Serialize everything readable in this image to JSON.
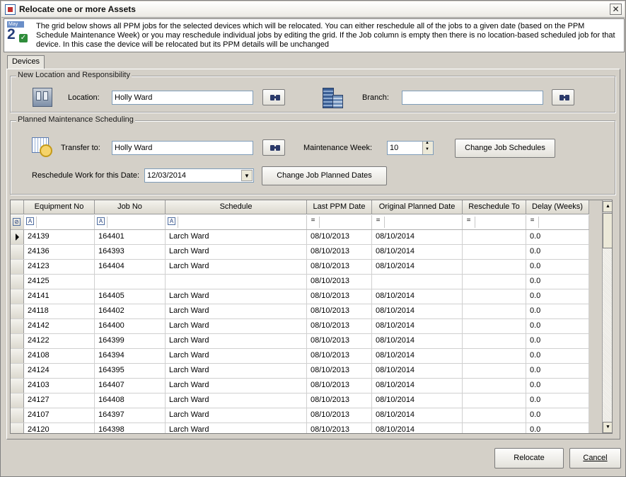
{
  "window": {
    "title": "Relocate one or more Assets",
    "close_label": "✕"
  },
  "info": {
    "calendar_month": "May",
    "calendar_day": "2",
    "text": "The grid below shows all PPM jobs for the selected devices which will be relocated. You can either reschedule all of the jobs to a given date (based on the PPM Schedule Maintenance Week) or you may reschedule individual jobs by editing the grid. If the Job column is empty then there is no location-based scheduled job for that device. In this case the device will be relocated but its PPM details will be unchanged"
  },
  "tabs": [
    {
      "label": "Devices"
    }
  ],
  "location_group": {
    "title": "New Location and Responsibility",
    "location_label": "Location:",
    "location_value": "Holly Ward",
    "branch_label": "Branch:",
    "branch_value": ""
  },
  "ppm_group": {
    "title": "Planned Maintenance Scheduling",
    "transfer_label": "Transfer to:",
    "transfer_value": "Holly Ward",
    "maint_week_label": "Maintenance Week:",
    "maint_week_value": "10",
    "change_schedules_label": "Change Job Schedules",
    "reschedule_label": "Reschedule Work for this Date:",
    "reschedule_date": "12/03/2014",
    "change_dates_label": "Change Job Planned Dates"
  },
  "grid": {
    "columns": [
      "Equipment No",
      "Job No",
      "Schedule",
      "Last PPM Date",
      "Original Planned Date",
      "Reschedule To",
      "Delay (Weeks)"
    ],
    "rows": [
      [
        "24139",
        "164401",
        "Larch Ward",
        "08/10/2013",
        "08/10/2014",
        "",
        "0.0"
      ],
      [
        "24136",
        "164393",
        "Larch Ward",
        "08/10/2013",
        "08/10/2014",
        "",
        "0.0"
      ],
      [
        "24123",
        "164404",
        "Larch Ward",
        "08/10/2013",
        "08/10/2014",
        "",
        "0.0"
      ],
      [
        "24125",
        "",
        "",
        "08/10/2013",
        "",
        "",
        "0.0"
      ],
      [
        "24141",
        "164405",
        "Larch Ward",
        "08/10/2013",
        "08/10/2014",
        "",
        "0.0"
      ],
      [
        "24118",
        "164402",
        "Larch Ward",
        "08/10/2013",
        "08/10/2014",
        "",
        "0.0"
      ],
      [
        "24142",
        "164400",
        "Larch Ward",
        "08/10/2013",
        "08/10/2014",
        "",
        "0.0"
      ],
      [
        "24122",
        "164399",
        "Larch Ward",
        "08/10/2013",
        "08/10/2014",
        "",
        "0.0"
      ],
      [
        "24108",
        "164394",
        "Larch Ward",
        "08/10/2013",
        "08/10/2014",
        "",
        "0.0"
      ],
      [
        "24124",
        "164395",
        "Larch Ward",
        "08/10/2013",
        "08/10/2014",
        "",
        "0.0"
      ],
      [
        "24103",
        "164407",
        "Larch Ward",
        "08/10/2013",
        "08/10/2014",
        "",
        "0.0"
      ],
      [
        "24127",
        "164408",
        "Larch Ward",
        "08/10/2013",
        "08/10/2014",
        "",
        "0.0"
      ],
      [
        "24107",
        "164397",
        "Larch Ward",
        "08/10/2013",
        "08/10/2014",
        "",
        "0.0"
      ],
      [
        "24120",
        "164398",
        "Larch Ward",
        "08/10/2013",
        "08/10/2014",
        "",
        "0.0"
      ]
    ],
    "filter_ops": [
      "A",
      "A",
      "A",
      "=",
      "=",
      "=",
      "="
    ]
  },
  "buttons": {
    "relocate": "Relocate",
    "cancel": "Cancel"
  }
}
